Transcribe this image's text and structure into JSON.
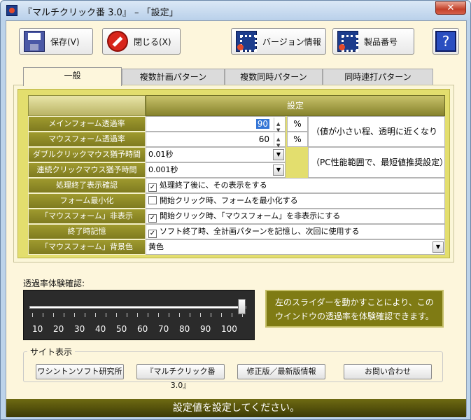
{
  "window": {
    "title": "『マルチクリック番 3.0』 – 「設定」",
    "close_glyph": "✕"
  },
  "toolbar": {
    "save_label": "保存(V)",
    "close_label": "閉じる(X)",
    "version_label": "バージョン情報",
    "product_label": "製品番号",
    "help_glyph": "?"
  },
  "tabs": [
    "一般",
    "複数計画パターン",
    "複数同時パターン",
    "同時連打パターン"
  ],
  "settings": {
    "header": "設定",
    "main_form_opacity": {
      "label": "メインフォーム透過率",
      "value": "90",
      "unit": "%"
    },
    "mouse_form_opacity": {
      "label": "マウスフォーム透過率",
      "value": "60",
      "unit": "%"
    },
    "opacity_note": "（値が小さい程、透明に近くなります）",
    "double_click_wait": {
      "label": "ダブルクリックマウス猶予時間",
      "value": "0.01秒"
    },
    "repeat_click_wait": {
      "label": "連続クリックマウス猶予時間",
      "value": "0.001秒"
    },
    "wait_note": "（PC性能範囲で、最短値推奨設定）",
    "finish_display": {
      "label": "処理終了表示確認",
      "text": "処理終了後に、その表示をする",
      "checked": true
    },
    "minimize_form": {
      "label": "フォーム最小化",
      "text": "開始クリック時、フォームを最小化する",
      "checked": false
    },
    "hide_mouse_form": {
      "label": "「マウスフォーム」非表示",
      "text": "開始クリック時、「マウスフォーム」を非表示にする",
      "checked": true
    },
    "remember_on_exit": {
      "label": "終了時記憶",
      "text": "ソフト終了時、全計画パターンを記憶し、次回に使用する",
      "checked": true
    },
    "mouse_form_bg": {
      "label": "「マウスフォーム」背景色",
      "value": "黄色"
    }
  },
  "transparency": {
    "label": "透過率体験確認:",
    "scale": [
      "10",
      "20",
      "30",
      "40",
      "50",
      "60",
      "70",
      "80",
      "90",
      "100"
    ],
    "slider_value": 100,
    "info": "左のスライダーを動かすことにより、このウインドウの透過率を体験確認できます。"
  },
  "sites": {
    "group_label": "サイト表示",
    "buttons": [
      "ワシントンソフト研究所",
      "『マルチクリック番 3.0』",
      "修正版／最新版情報",
      "お問い合わせ"
    ]
  },
  "status": "設定値を設定してください。"
}
